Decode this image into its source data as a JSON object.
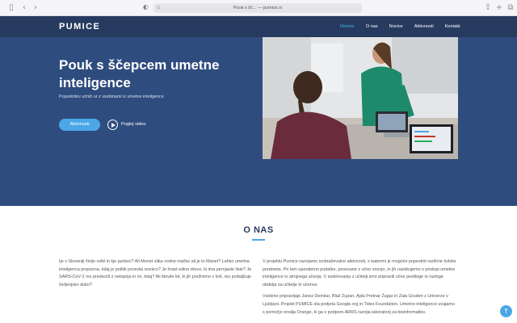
{
  "browser": {
    "url": "Pouk s šč... — pumice.si",
    "back_icon": "‹",
    "forward_icon": "›"
  },
  "header": {
    "logo": "PUMICE",
    "nav": [
      "Domov",
      "O nas",
      "Novice",
      "Aktivnosti",
      "Kontakt"
    ],
    "active": "Domov"
  },
  "hero": {
    "title": "Pouk s ščepcem umetne inteligence",
    "subtitle": "Popestritev učnih ur z vsebinami iz umetne inteligence",
    "primary_button": "Aktivnosti",
    "video_label": "Poglej video"
  },
  "about": {
    "title": "O NAS",
    "left": [
      "Ije v Sloveniji živijo volki in kje jazbeci? Ali Monet slika vodne mačke ali je to Manet? Lahko umetna inteligenca prepozna, kdaj je politik povedal resnico? Je hrast edino drevo, ki ima pernjaste liste? Je SARS-CoV-2 res preskočil z netopirja in če, kdaj? Ali štovile lot, ki jih preživimo v šoli, res podaljšuje življenjsko dobo?"
    ],
    "right": [
      "V projektu Pumice razvijamo izobraževalne aktivnosti, s katerimi je mogoče popestriti različne šolske predmete. Pri tem uporabimo podatke, povezane z učno snovjo, in jih raziskujemo s pristopi umetne inteligence in strojnega učenja. V sodelovanju z učitelji smo pripravili učne predloge in razloge obdelja za učitelje in učence.",
      "Vsebine pripravljajo Janez Demšar, Blaž Zupan, Ajda Pretnar Žagar in Zala Gruden z Univerze v Ljubljani. Projekt PUMICE sta podprla Google.org in Tides Foundation. Umetno inteligenco uvajamo s pomočjo orodja Orange, ki ga s podporo ARRS razvija laboratorij za bioinformatiko."
    ]
  },
  "colors": {
    "header_bg": "#273a5f",
    "hero_bg": "#2f4c7e",
    "accent": "#4aa7e8"
  }
}
